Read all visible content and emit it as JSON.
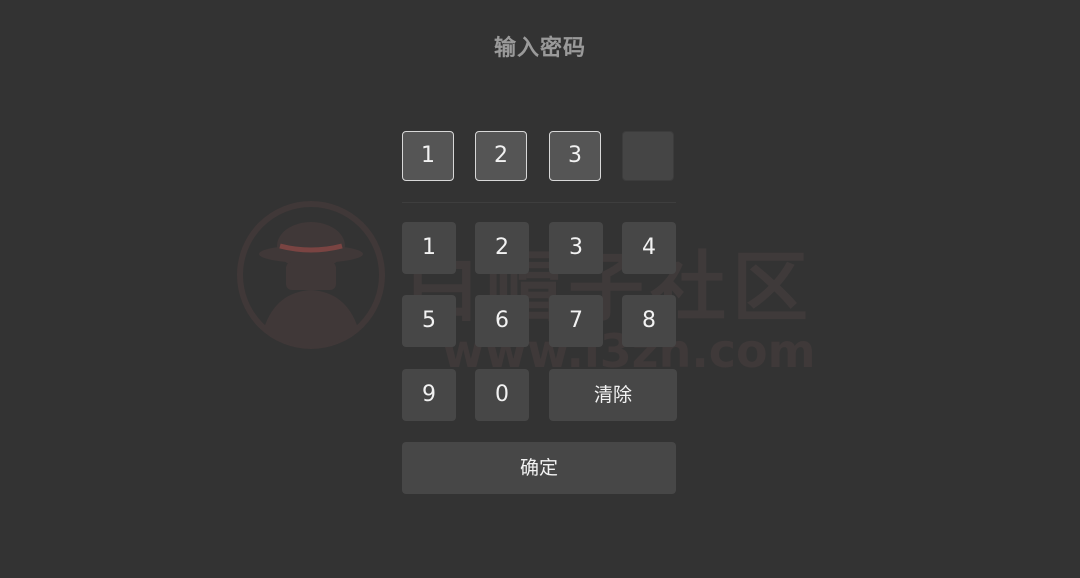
{
  "title": "输入密码",
  "pin_display": [
    "1",
    "2",
    "3",
    ""
  ],
  "keypad": {
    "keys": [
      "1",
      "2",
      "3",
      "4",
      "5",
      "6",
      "7",
      "8",
      "9",
      "0"
    ],
    "clear_label": "清除",
    "confirm_label": "确定"
  },
  "watermark": {
    "text": "白帽子社区",
    "url": "www.i3zh.com"
  }
}
